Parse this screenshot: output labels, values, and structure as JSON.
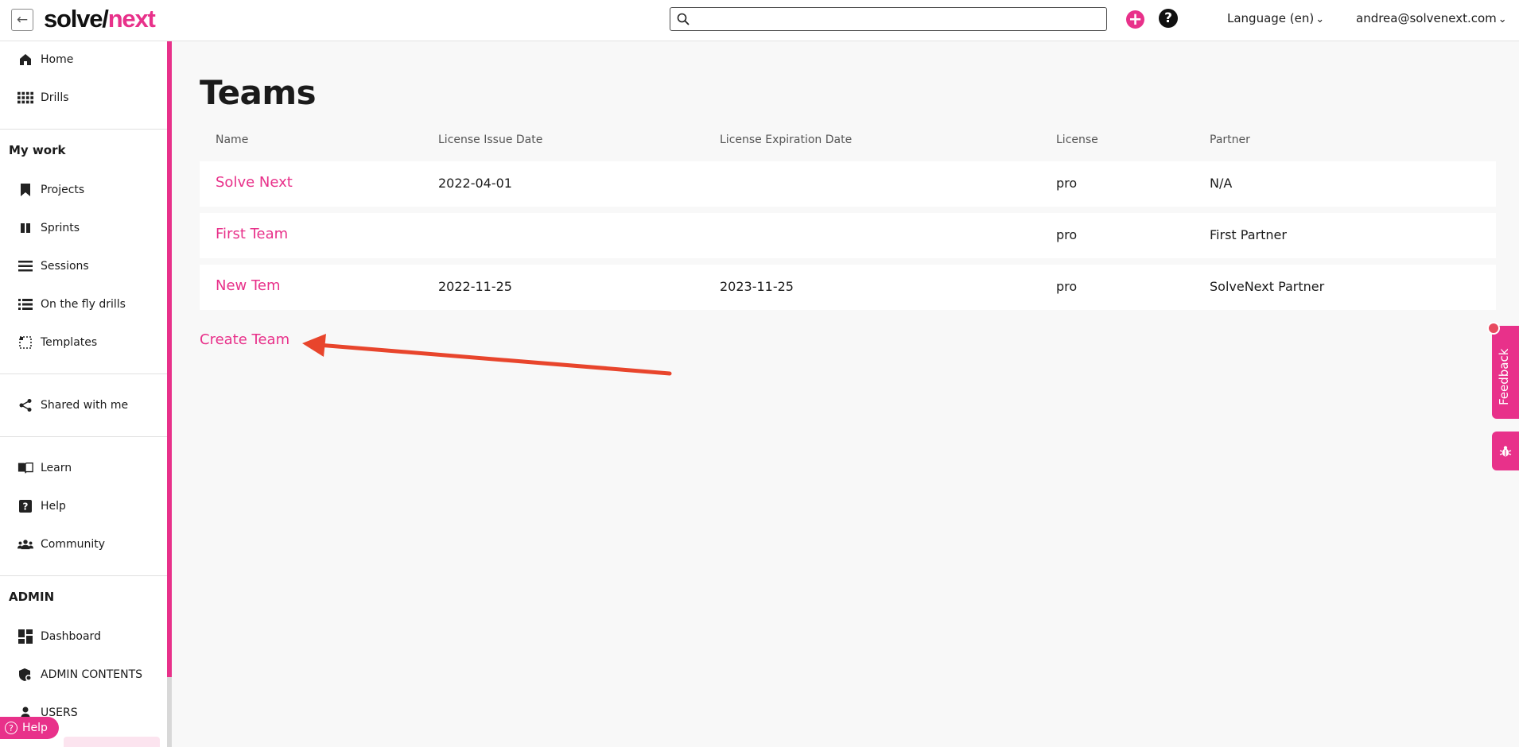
{
  "header": {
    "logo_part1": "solve/",
    "logo_part2": "next",
    "search_placeholder": "",
    "language_label": "Language (en)",
    "user_email": "andrea@solvenext.com",
    "accent_color": "#e8318a"
  },
  "sidebar": {
    "top_items": [
      {
        "label": "Home",
        "icon": "home-icon"
      },
      {
        "label": "Drills",
        "icon": "grid-icon"
      }
    ],
    "my_work_label": "My work",
    "my_work_items": [
      {
        "label": "Projects",
        "icon": "bookmark-icon"
      },
      {
        "label": "Sprints",
        "icon": "columns-icon"
      },
      {
        "label": "Sessions",
        "icon": "list-icon"
      },
      {
        "label": "On the fly drills",
        "icon": "list-detail-icon"
      },
      {
        "label": "Templates",
        "icon": "template-icon"
      }
    ],
    "shared_items": [
      {
        "label": "Shared with me",
        "icon": "share-icon"
      }
    ],
    "learn_items": [
      {
        "label": "Learn",
        "icon": "book-icon"
      },
      {
        "label": "Help",
        "icon": "help-icon"
      },
      {
        "label": "Community",
        "icon": "people-icon"
      }
    ],
    "admin_label": "ADMIN",
    "admin_items": [
      {
        "label": "Dashboard",
        "icon": "dashboard-icon"
      },
      {
        "label": "ADMIN CONTENTS",
        "icon": "shield-icon"
      },
      {
        "label": "USERS",
        "icon": "users-icon"
      }
    ],
    "help_pill_label": "Help"
  },
  "main": {
    "title": "Teams",
    "columns": [
      "Name",
      "License Issue Date",
      "License Expiration Date",
      "License",
      "Partner"
    ],
    "rows": [
      {
        "name": "Solve Next",
        "issue_date": "2022-04-01",
        "expiration_date": "",
        "license": "pro",
        "partner": "N/A"
      },
      {
        "name": "First Team",
        "issue_date": "",
        "expiration_date": "",
        "license": "pro",
        "partner": "First Partner"
      },
      {
        "name": "New Tem",
        "issue_date": "2022-11-25",
        "expiration_date": "2023-11-25",
        "license": "pro",
        "partner": "SolveNext Partner"
      }
    ],
    "create_label": "Create Team"
  },
  "feedback": {
    "label": "Feedback"
  }
}
